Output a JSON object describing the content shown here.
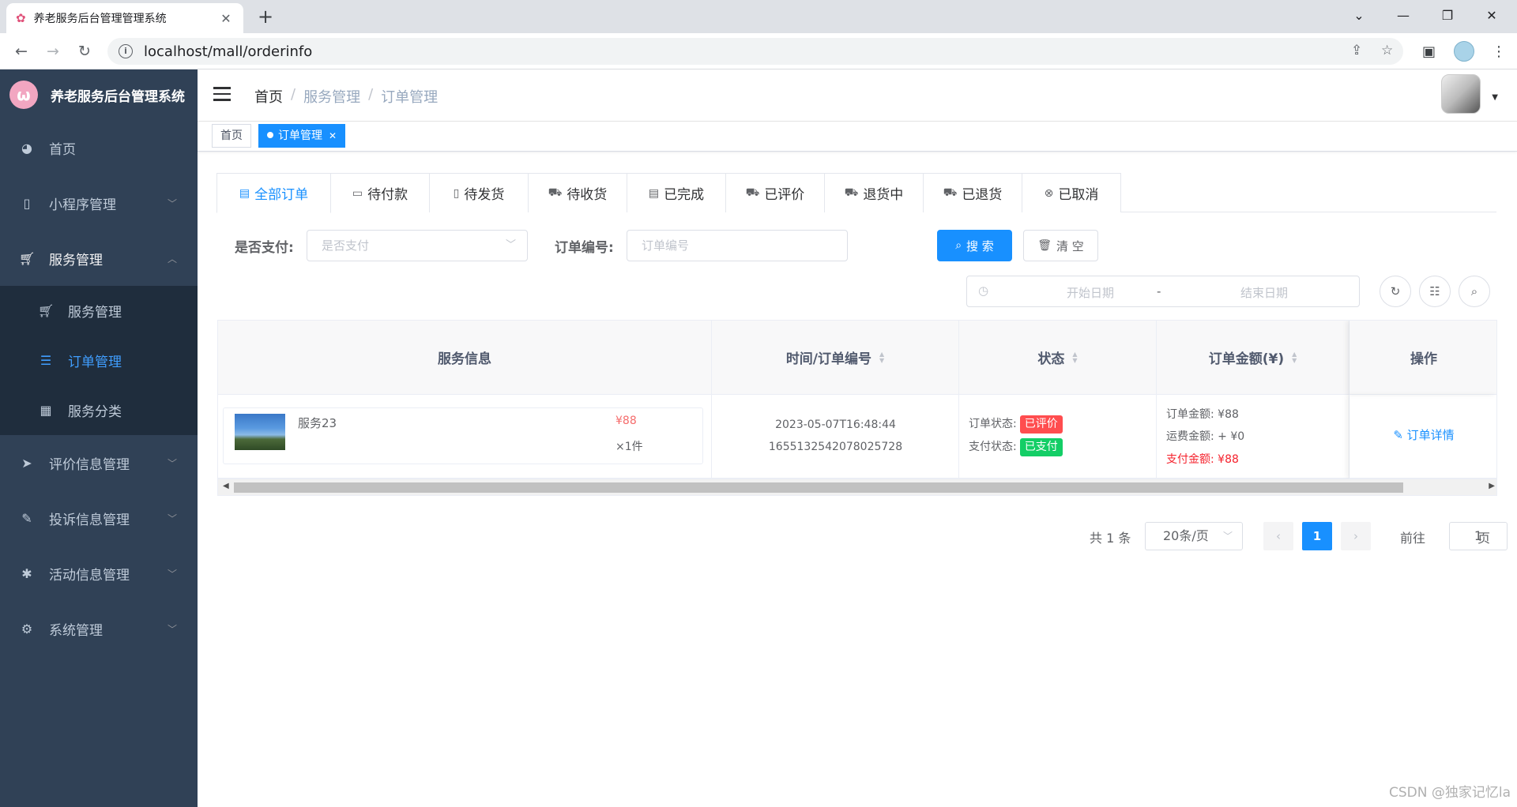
{
  "browser": {
    "tab_title": "养老服务后台管理管理系统",
    "url": "localhost/mall/orderinfo"
  },
  "sidebar": {
    "logo_text": "养老服务后台管理系统",
    "items": [
      {
        "label": "首页",
        "icon": "dashboard-icon"
      },
      {
        "label": "小程序管理",
        "icon": "phone-icon"
      },
      {
        "label": "服务管理",
        "icon": "cart-icon"
      },
      {
        "label": "评价信息管理",
        "icon": "send-icon"
      },
      {
        "label": "投诉信息管理",
        "icon": "edit-doc-icon"
      },
      {
        "label": "活动信息管理",
        "icon": "bug-icon"
      },
      {
        "label": "系统管理",
        "icon": "gear-icon"
      }
    ],
    "sub_items": [
      {
        "label": "服务管理",
        "icon": "cart-icon"
      },
      {
        "label": "订单管理",
        "icon": "list-icon"
      },
      {
        "label": "服务分类",
        "icon": "table-icon"
      }
    ]
  },
  "header": {
    "breadcrumb": [
      "首页",
      "服务管理",
      "订单管理"
    ]
  },
  "tags": {
    "home": "首页",
    "active": "订单管理"
  },
  "order_tabs": [
    "全部订单",
    "待付款",
    "待发货",
    "待收货",
    "已完成",
    "已评价",
    "退货中",
    "已退货",
    "已取消"
  ],
  "filters": {
    "paid_label": "是否支付:",
    "paid_placeholder": "是否支付",
    "order_no_label": "订单编号:",
    "order_no_placeholder": "订单编号",
    "search_button": "搜 索",
    "clear_button": "清 空",
    "date_start_placeholder": "开始日期",
    "date_separator": "-",
    "date_end_placeholder": "结束日期"
  },
  "table": {
    "headers": [
      "服务信息",
      "时间/订单编号",
      "状态",
      "订单金额(¥)",
      "操作"
    ],
    "rows": [
      {
        "service_name": "服务23",
        "price": "¥88",
        "qty": "×1件",
        "time": "2023-05-07T16:48:44",
        "order_no": "1655132542078025728",
        "order_status_label": "订单状态:",
        "order_status": "已评价",
        "pay_status_label": "支付状态:",
        "pay_status": "已支付",
        "amount_label": "订单金额: ¥88",
        "freight_label": "运费金额: + ¥0",
        "paid_label": "支付金额: ¥88",
        "action": "订单详情"
      }
    ]
  },
  "pagination": {
    "total": "共 1 条",
    "page_size": "20条/页",
    "current": "1",
    "goto_prefix": "前往",
    "goto_value": "1",
    "goto_suffix": "页"
  },
  "watermark": "CSDN @独家记忆la",
  "colors": {
    "sidebar_bg": "#304156",
    "submenu_bg": "#1f2d3d",
    "primary": "#1890ff",
    "danger": "#ff4d4f",
    "success": "#13ce66"
  }
}
